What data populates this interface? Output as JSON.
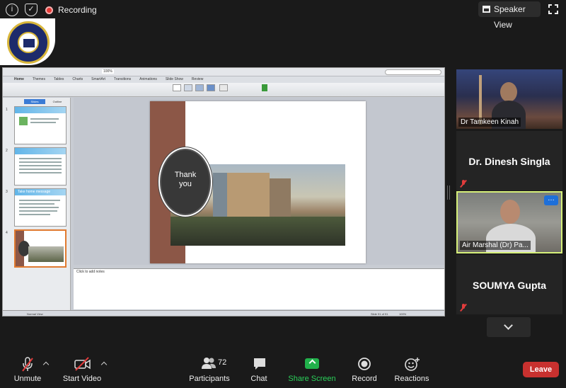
{
  "topbar": {
    "recording_label": "Recording",
    "speaker_view_label": "Speaker View"
  },
  "presentation": {
    "ppt_tabs": [
      "Home",
      "Themes",
      "Tables",
      "Charts",
      "SmartArt",
      "Transitions",
      "Animations",
      "Slide Show",
      "Review"
    ],
    "zoom": "100%",
    "side_tabs": [
      "Slides",
      "Outline"
    ],
    "thumbnails": [
      {
        "num": "1",
        "title": ""
      },
      {
        "num": "2",
        "title": ""
      },
      {
        "num": "3",
        "title": "Take home message"
      },
      {
        "num": "4",
        "title": ""
      }
    ],
    "slide_text_line1": "Thank",
    "slide_text_line2": "you",
    "notes_placeholder": "Click to add notes",
    "status_view": "Normal View",
    "status_slide": "Slide 91 of 91",
    "status_zoom": "100%"
  },
  "participants_tiles": [
    {
      "name": "Dr Tamkeen Kinah",
      "type": "video"
    },
    {
      "name": "Dr. Dinesh Singla",
      "type": "name-only",
      "muted": true
    },
    {
      "name": "Air Marshal (Dr) Pa...",
      "type": "video",
      "active": true
    },
    {
      "name": "SOUMYA Gupta",
      "type": "name-only",
      "muted": true
    }
  ],
  "toolbar": {
    "unmute_label": "Unmute",
    "start_video_label": "Start Video",
    "participants_label": "Participants",
    "participants_count": "72",
    "chat_label": "Chat",
    "share_screen_label": "Share Screen",
    "record_label": "Record",
    "reactions_label": "Reactions",
    "leave_label": "Leave"
  },
  "colors": {
    "share_green": "#21b14b",
    "leave_red": "#c8312f",
    "active_border": "#d6f07a",
    "more_blue": "#1e6fd9"
  }
}
